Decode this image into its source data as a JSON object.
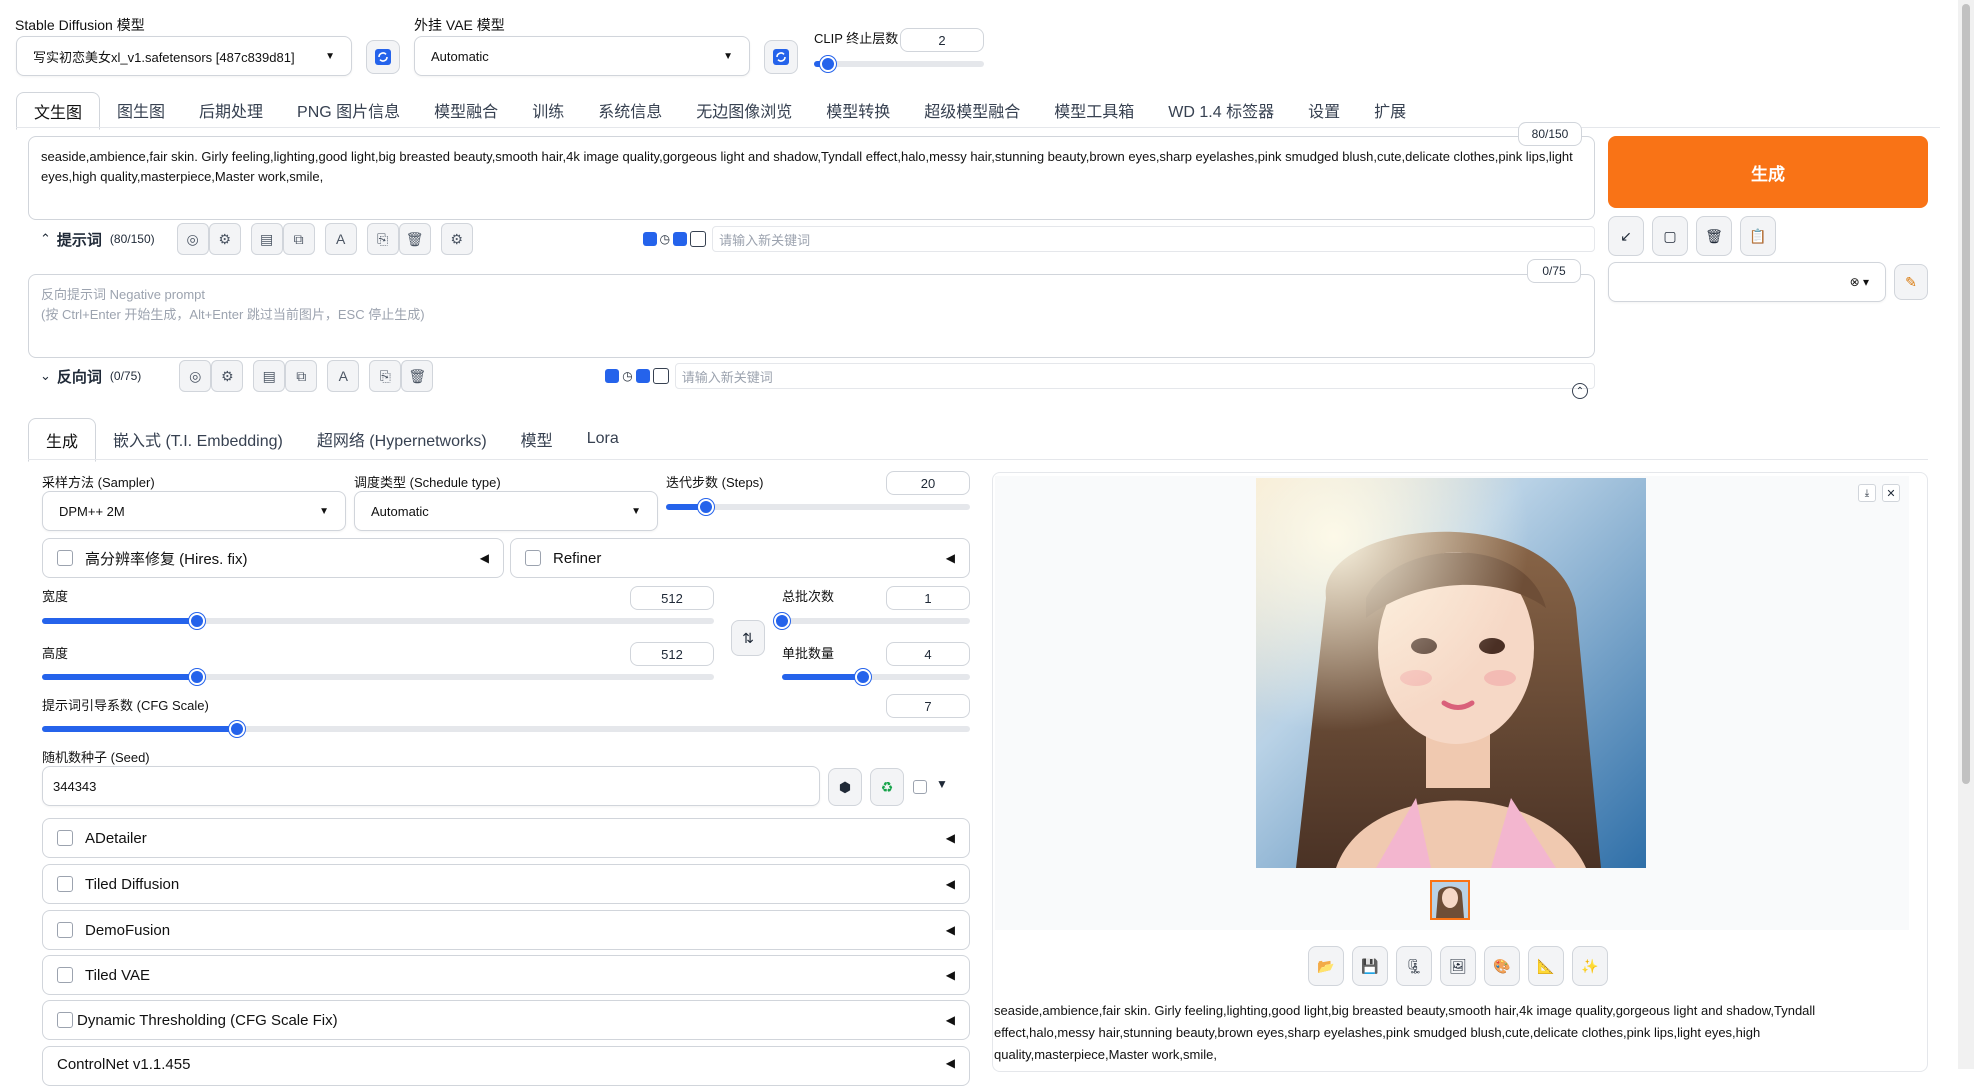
{
  "top": {
    "sd_model_label": "Stable Diffusion 模型",
    "sd_model_value": "写实初恋美女xl_v1.safetensors [487c839d81]",
    "vae_label": "外挂 VAE 模型",
    "vae_value": "Automatic",
    "clip_label": "CLIP 终止层数",
    "clip_value": "2",
    "clip_fraction": 0.08
  },
  "tabs": [
    "文生图",
    "图生图",
    "后期处理",
    "PNG 图片信息",
    "模型融合",
    "训练",
    "系统信息",
    "无边图像浏览",
    "模型转换",
    "超级模型融合",
    "模型工具箱",
    "WD 1.4 标签器",
    "设置",
    "扩展"
  ],
  "prompt": {
    "counter": "80/150",
    "text": "seaside,ambience,fair skin. Girly feeling,lighting,good light,big breasted beauty,smooth hair,4k image quality,gorgeous light and shadow,Tyndall effect,halo,messy hair,stunning beauty,brown eyes,sharp eyelashes,pink smudged blush,cute,delicate clothes,pink lips,light eyes,high quality,masterpiece,Master work,smile,",
    "toolbar_title": "提示词",
    "toolbar_count": "(80/150)",
    "keyword_placeholder": "请输入新关键词"
  },
  "negative": {
    "counter": "0/75",
    "placeholder_line1": "反向提示词 Negative prompt",
    "placeholder_line2": "(按 Ctrl+Enter 开始生成，Alt+Enter 跳过当前图片，ESC 停止生成)",
    "toolbar_title": "反向词",
    "toolbar_count": "(0/75)",
    "keyword_placeholder": "请输入新关键词"
  },
  "generate_label": "生成",
  "subtabs": [
    "生成",
    "嵌入式 (T.I. Embedding)",
    "超网络 (Hypernetworks)",
    "模型",
    "Lora"
  ],
  "params": {
    "sampler_label": "采样方法 (Sampler)",
    "sampler_value": "DPM++ 2M",
    "schedule_label": "调度类型 (Schedule type)",
    "schedule_value": "Automatic",
    "steps_label": "迭代步数 (Steps)",
    "steps_value": "20",
    "steps_fraction": 0.13,
    "hires_label": "高分辨率修复 (Hires. fix)",
    "refiner_label": "Refiner",
    "width_label": "宽度",
    "width_value": "512",
    "width_fraction": 0.23,
    "height_label": "高度",
    "height_value": "512",
    "height_fraction": 0.23,
    "batch_count_label": "总批次数",
    "batch_count_value": "1",
    "batch_count_fraction": 0.0,
    "batch_size_label": "单批数量",
    "batch_size_value": "4",
    "batch_size_fraction": 0.43,
    "cfg_label": "提示词引导系数 (CFG Scale)",
    "cfg_value": "7",
    "cfg_fraction": 0.21,
    "seed_label": "随机数种子 (Seed)",
    "seed_value": "344343"
  },
  "accordions": [
    "ADetailer",
    "Tiled Diffusion",
    "DemoFusion",
    "Tiled VAE",
    "Dynamic Thresholding (CFG Scale Fix)",
    "ControlNet v1.1.455"
  ],
  "output": {
    "caption": "seaside,ambience,fair skin. Girly feeling,lighting,good light,big breasted beauty,smooth hair,4k image quality,gorgeous light and shadow,Tyndall effect,halo,messy hair,stunning beauty,brown eyes,sharp eyelashes,pink smudged blush,cute,delicate clothes,pink lips,light eyes,high quality,masterpiece,Master work,smile,"
  },
  "colors": {
    "accent": "#2563eb",
    "generate": "#f97316"
  }
}
